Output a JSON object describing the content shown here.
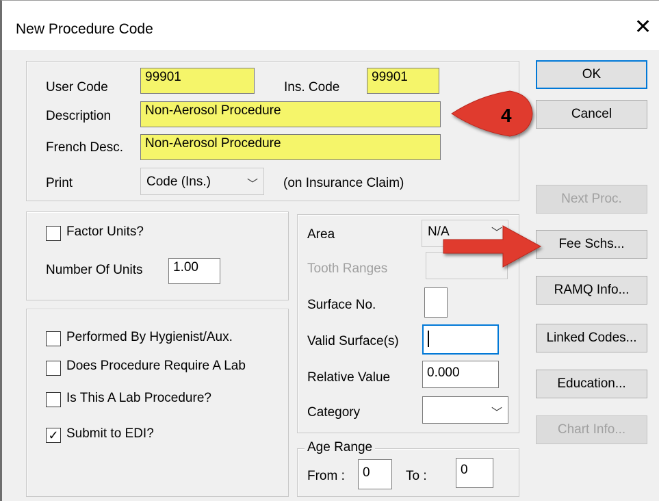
{
  "window": {
    "title": "New Procedure Code",
    "close_glyph": "✕"
  },
  "codes": {
    "user_code_label": "User Code",
    "user_code_value": "99901",
    "ins_code_label": "Ins. Code",
    "ins_code_value": "99901",
    "description_label": "Description",
    "description_value": "Non-Aerosol Procedure",
    "french_label": "French Desc.",
    "french_value": "Non-Aerosol Procedure",
    "print_label": "Print",
    "print_value": "Code (Ins.)",
    "print_note": "(on Insurance Claim)"
  },
  "units": {
    "factor_label": "Factor Units?",
    "factor_checked": false,
    "number_label": "Number Of Units",
    "number_value": "1.00"
  },
  "flags": [
    {
      "label": "Performed By Hygienist/Aux.",
      "checked": false
    },
    {
      "label": "Does Procedure Require A Lab",
      "checked": false
    },
    {
      "label": "Is This A Lab Procedure?",
      "checked": false
    },
    {
      "label": "Submit to EDI?",
      "checked": true
    }
  ],
  "area": {
    "area_label": "Area",
    "area_value": "N/A",
    "tooth_ranges_label": "Tooth Ranges",
    "surface_no_label": "Surface No.",
    "valid_surfaces_label": "Valid Surface(s)",
    "relative_value_label": "Relative Value",
    "relative_value": "0.000",
    "category_label": "Category",
    "category_value": ""
  },
  "age_range": {
    "legend": "Age Range",
    "from_label": "From :",
    "from_value": "0",
    "to_label": "To :",
    "to_value": "0"
  },
  "buttons": {
    "ok": "OK",
    "cancel": "Cancel",
    "next_proc": "Next Proc.",
    "fee_schs": "Fee Schs...",
    "ramq_info": "RAMQ Info...",
    "linked_codes": "Linked Codes...",
    "education": "Education...",
    "chart_info": "Chart Info..."
  },
  "annotation": {
    "step_number": "4",
    "color": "#e03a2e"
  }
}
